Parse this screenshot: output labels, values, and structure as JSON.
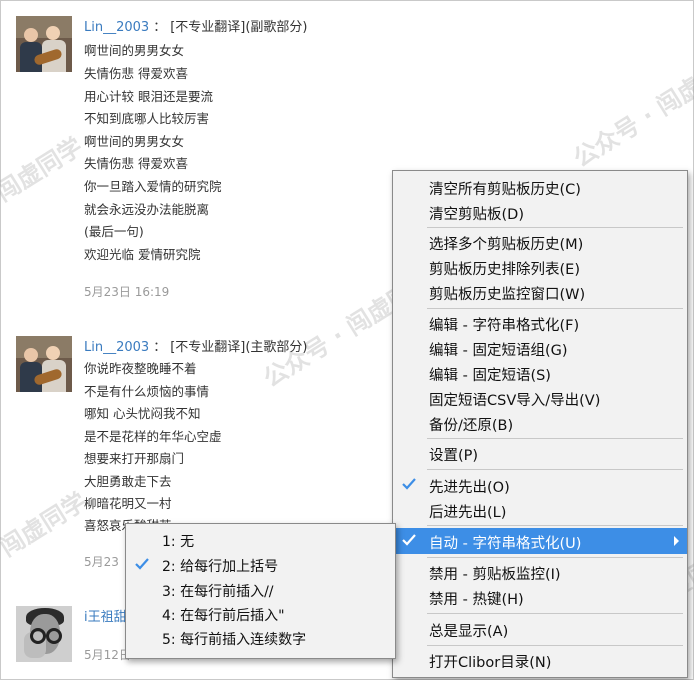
{
  "watermark": [
    "闯虚同学",
    "公众号 · 闯虚同学",
    "公众号 · 闯虚同学",
    "闯虚同学",
    "闯虚同学"
  ],
  "comments": [
    {
      "user": "Lin__2003",
      "sep": "：",
      "tag": "[不专业翻译](副歌部分)",
      "lines": [
        "啊世间的男男女女",
        "失情伤悲 得爱欢喜",
        "用心计较 眼泪还是要流",
        "不知到底哪人比较厉害",
        "啊世间的男男女女",
        "失情伤悲 得爱欢喜",
        "你一旦踏入爱情的研究院",
        "就会永远没办法能脱离",
        "(最后一句)",
        "欢迎光临 爱情研究院"
      ],
      "date": "5月23日 16:19"
    },
    {
      "user": "Lin__2003",
      "sep": "：",
      "tag": "[不专业翻译](主歌部分)",
      "lines": [
        "你说昨夜整晚睡不着",
        "不是有什么烦恼的事情",
        "哪知 心头忧闷我不知",
        "是不是花样的年华心空虚",
        "想要来打开那扇门",
        "大胆勇敢走下去",
        "柳暗花明又一村",
        "喜怒哀乐酸甜苦"
      ],
      "date": "5月23"
    },
    {
      "user": "i王祖甜",
      "date": "5月12日 16:06"
    }
  ],
  "context_menu": {
    "items": [
      {
        "label": "清空所有剪贴板历史(C)"
      },
      {
        "label": "清空剪贴板(D)"
      },
      {
        "label": "选择多个剪贴板历史(M)"
      },
      {
        "label": "剪贴板历史排除列表(E)"
      },
      {
        "label": "剪贴板历史监控窗口(W)"
      },
      {
        "label": "编辑 - 字符串格式化(F)"
      },
      {
        "label": "编辑 - 固定短语组(G)"
      },
      {
        "label": "编辑 - 固定短语(S)"
      },
      {
        "label": "固定短语CSV导入/导出(V)"
      },
      {
        "label": "备份/还原(B)"
      },
      {
        "label": "设置(P)"
      },
      {
        "label": "先进先出(O)",
        "checked": true
      },
      {
        "label": "后进先出(L)"
      },
      {
        "label": "自动 - 字符串格式化(U)",
        "checked": true,
        "highlighted": true,
        "submenu": true
      },
      {
        "label": "禁用 - 剪贴板监控(I)"
      },
      {
        "label": "禁用 - 热键(H)"
      },
      {
        "label": "总是显示(A)"
      },
      {
        "label": "打开Clibor目录(N)"
      }
    ]
  },
  "submenu": {
    "items": [
      {
        "label": "1: 无"
      },
      {
        "label": "2: 给每行加上括号",
        "checked": true
      },
      {
        "label": "3: 在每行前插入//"
      },
      {
        "label": "4: 在每行前后插入\""
      },
      {
        "label": "5: 每行前插入连续数字"
      }
    ]
  },
  "colors": {
    "highlight": "#3d8ee6",
    "username": "#3a7bbf",
    "check": "#3d8ee6"
  }
}
